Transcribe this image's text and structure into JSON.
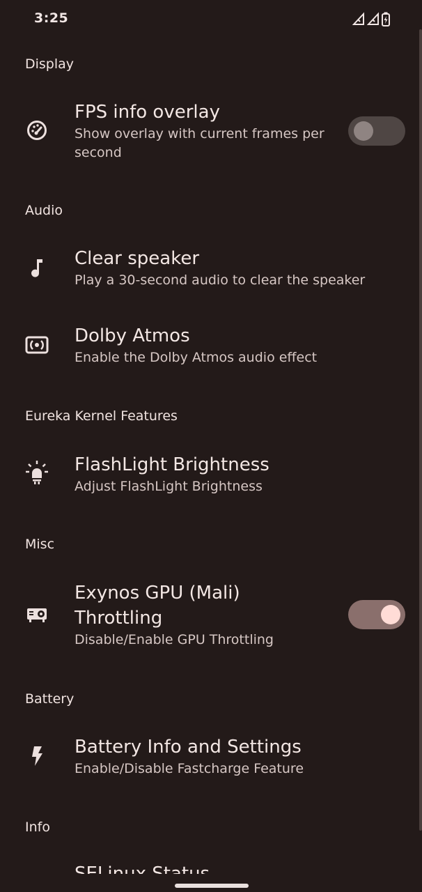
{
  "status_bar": {
    "time": "3:25",
    "icons": [
      "signal-icon",
      "signal-icon",
      "battery-charging-icon"
    ]
  },
  "sections": {
    "display": {
      "header": "Display"
    },
    "audio": {
      "header": "Audio"
    },
    "kernel": {
      "header": "Eureka Kernel Features"
    },
    "misc": {
      "header": "Misc"
    },
    "battery": {
      "header": "Battery"
    },
    "info": {
      "header": "Info"
    }
  },
  "items": {
    "fps": {
      "title": "FPS info overlay",
      "summary": "Show overlay with current frames per second",
      "toggle_on": false,
      "icon": "speedometer-icon"
    },
    "clear_speaker": {
      "title": "Clear speaker",
      "summary": "Play a 30-second audio to clear the speaker",
      "icon": "music-note-icon"
    },
    "dolby": {
      "title": "Dolby Atmos",
      "summary": "Enable the Dolby Atmos audio effect",
      "icon": "surround-sound-icon"
    },
    "flashlight": {
      "title": "FlashLight Brightness",
      "summary": "Adjust FlashLight Brightness",
      "icon": "flashlight-icon"
    },
    "gpu": {
      "title_line1": "Exynos GPU (Mali)",
      "title_line2": "Throttling",
      "summary": "Disable/Enable GPU Throttling",
      "toggle_on": true,
      "icon": "gpu-icon"
    },
    "battery_info": {
      "title": "Battery Info and Settings",
      "summary": "Enable/Disable Fastcharge Feature",
      "icon": "flash-icon"
    },
    "selinux": {
      "title": "SELinux Status"
    }
  },
  "colors": {
    "background": "#231a19",
    "accent_knob": "#ffdcd6",
    "track_on": "#8a6f6c",
    "track_off": "#4f4644"
  }
}
